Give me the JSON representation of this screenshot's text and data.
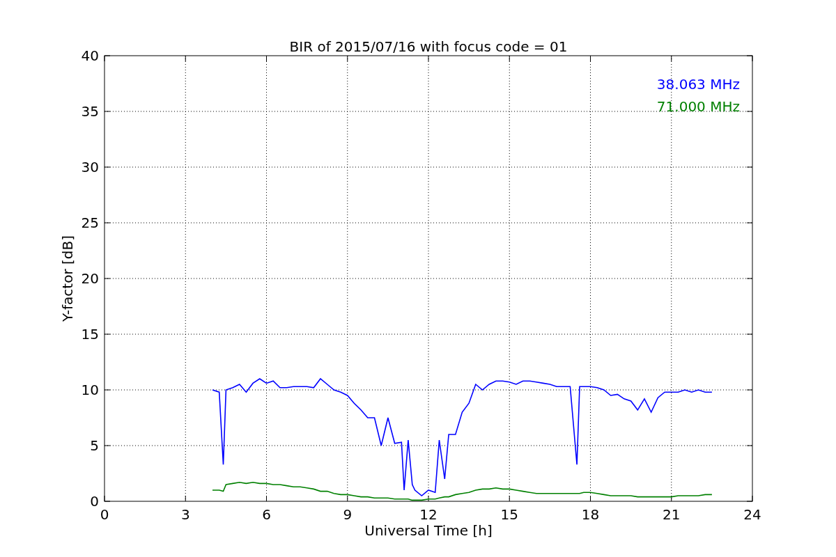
{
  "figure": {
    "chart_data": {
      "type": "line",
      "grid": true,
      "title": "BIR of 2015/07/16 with focus code = 01",
      "xlabel": "Universal Time [h]",
      "ylabel": "Y-factor [dB]",
      "xlim": [
        0,
        24
      ],
      "ylim": [
        0,
        40
      ],
      "xticks": [
        0,
        3,
        6,
        9,
        12,
        15,
        18,
        21,
        24
      ],
      "yticks": [
        0,
        5,
        10,
        15,
        20,
        25,
        30,
        35,
        40
      ],
      "x": [
        4,
        4.25,
        4.4,
        4.5,
        4.75,
        5,
        5.25,
        5.5,
        5.75,
        6,
        6.25,
        6.5,
        6.75,
        7,
        7.25,
        7.5,
        7.75,
        8,
        8.25,
        8.5,
        8.75,
        9,
        9.25,
        9.5,
        9.75,
        10,
        10.25,
        10.5,
        10.75,
        11,
        11.1,
        11.25,
        11.4,
        11.5,
        11.75,
        12,
        12.25,
        12.4,
        12.6,
        12.75,
        13,
        13.25,
        13.5,
        13.75,
        14,
        14.25,
        14.5,
        14.75,
        15,
        15.25,
        15.5,
        15.75,
        16,
        16.25,
        16.5,
        16.75,
        17,
        17.25,
        17.5,
        17.6,
        17.75,
        18,
        18.25,
        18.5,
        18.75,
        19,
        19.25,
        19.5,
        19.75,
        20,
        20.25,
        20.5,
        20.75,
        21,
        21.25,
        21.5,
        21.75,
        22,
        22.25,
        22.5
      ],
      "series": [
        {
          "name": "38.063 MHz",
          "color": "#0000ff",
          "values": [
            10,
            9.8,
            3.3,
            10,
            10.2,
            10.5,
            9.8,
            10.6,
            11,
            10.6,
            10.8,
            10.2,
            10.2,
            10.3,
            10.3,
            10.3,
            10.2,
            11,
            10.5,
            10,
            9.8,
            9.5,
            8.8,
            8.2,
            7.5,
            7.5,
            5,
            7.5,
            5.2,
            5.3,
            1,
            5.5,
            1.5,
            1,
            0.5,
            1,
            0.8,
            5.5,
            2,
            6,
            6,
            8,
            8.8,
            10.5,
            10,
            10.5,
            10.8,
            10.8,
            10.7,
            10.5,
            10.8,
            10.8,
            10.7,
            10.6,
            10.5,
            10.3,
            10.3,
            10.3,
            3.3,
            10.3,
            10.3,
            10.3,
            10.2,
            10,
            9.5,
            9.6,
            9.2,
            9,
            8.2,
            9.2,
            8,
            9.3,
            9.8,
            9.8,
            9.8,
            10,
            9.8,
            10,
            9.8,
            9.8
          ]
        },
        {
          "name": "71.000 MHz",
          "color": "#008000",
          "values": [
            1,
            1,
            0.9,
            1.5,
            1.6,
            1.7,
            1.6,
            1.7,
            1.6,
            1.6,
            1.5,
            1.5,
            1.4,
            1.3,
            1.3,
            1.2,
            1.1,
            0.9,
            0.9,
            0.7,
            0.6,
            0.6,
            0.5,
            0.4,
            0.4,
            0.3,
            0.3,
            0.3,
            0.2,
            0.2,
            0.2,
            0.2,
            0.1,
            0.1,
            0.1,
            0.2,
            0.2,
            0.3,
            0.4,
            0.4,
            0.6,
            0.7,
            0.8,
            1,
            1.1,
            1.1,
            1.2,
            1.1,
            1.1,
            1,
            0.9,
            0.8,
            0.7,
            0.7,
            0.7,
            0.7,
            0.7,
            0.7,
            0.7,
            0.7,
            0.8,
            0.8,
            0.7,
            0.6,
            0.5,
            0.5,
            0.5,
            0.5,
            0.4,
            0.4,
            0.4,
            0.4,
            0.4,
            0.4,
            0.5,
            0.5,
            0.5,
            0.5,
            0.6,
            0.6
          ]
        }
      ]
    }
  }
}
